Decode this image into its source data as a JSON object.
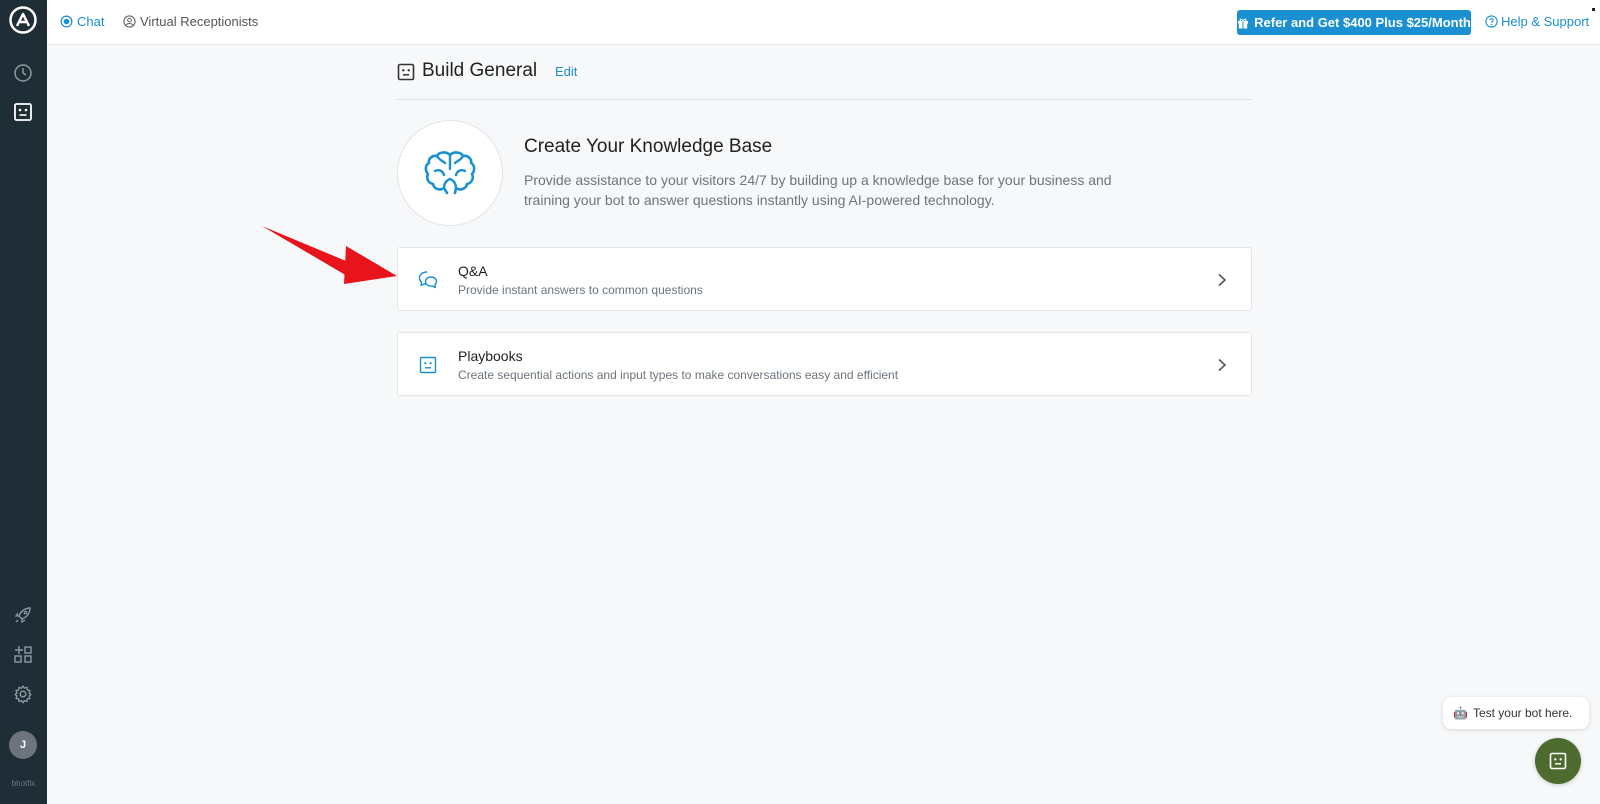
{
  "topbar": {
    "tabs": [
      {
        "label": "Chat",
        "icon": "chat-bubble-icon",
        "active": true
      },
      {
        "label": "Virtual Receptionists",
        "icon": "receptionist-icon",
        "active": false
      }
    ],
    "refer_label": "Refer and Get $400 Plus $25/Month",
    "help_label": "Help & Support"
  },
  "sidebar": {
    "items": [
      {
        "name": "history",
        "icon": "clock-icon"
      },
      {
        "name": "bots",
        "icon": "bot-icon",
        "active": true
      },
      {
        "name": "launch",
        "icon": "rocket-icon"
      },
      {
        "name": "apps",
        "icon": "grid-add-icon"
      },
      {
        "name": "settings",
        "icon": "gear-icon"
      }
    ],
    "avatar_initial": "J",
    "brand": "bhotfix"
  },
  "header": {
    "title": "Build General",
    "edit_label": "Edit"
  },
  "intro": {
    "title": "Create Your Knowledge Base",
    "description": "Provide assistance to your visitors 24/7 by building up a knowledge base for your business and training your bot to answer questions instantly using AI-powered technology."
  },
  "cards": [
    {
      "title": "Q&A",
      "description": "Provide instant answers to common questions",
      "icon": "qa-bubbles-icon"
    },
    {
      "title": "Playbooks",
      "description": "Create sequential actions and input types to make conversations easy and efficient",
      "icon": "bot-icon"
    }
  ],
  "test_bot": {
    "bubble_text": "Test your bot here.",
    "emoji": "🤖"
  },
  "colors": {
    "accent": "#1a8fd1",
    "sidebar": "#1f2d36",
    "fab": "#4d6b2e",
    "annotation_arrow": "#e8141b"
  }
}
